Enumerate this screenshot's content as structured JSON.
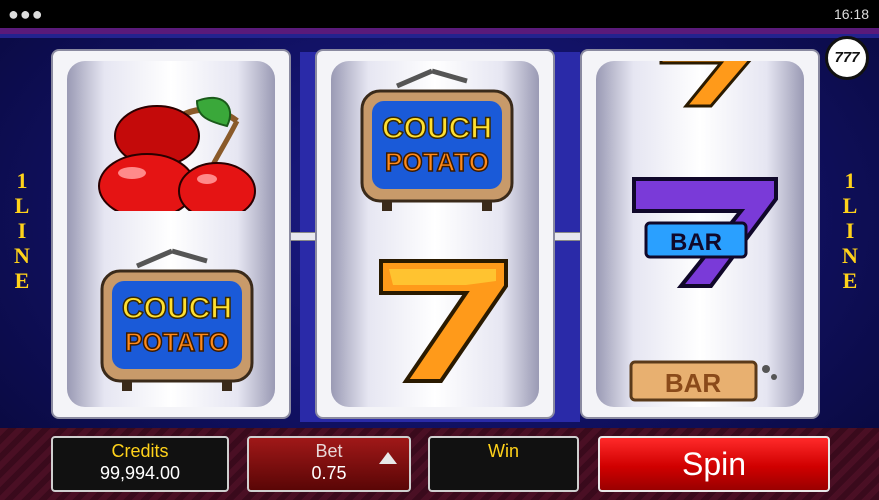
{
  "status_bar": {
    "menu_icon": "ellipsis-icon",
    "time": "16:18"
  },
  "game": {
    "logo": "777",
    "paylines_left": [
      "1",
      "L",
      "I",
      "N",
      "E"
    ],
    "paylines_right": [
      "1",
      "L",
      "I",
      "N",
      "E"
    ],
    "reels": [
      {
        "symbols": [
          "cherries",
          "couch-potato"
        ]
      },
      {
        "symbols": [
          "couch-potato",
          "seven"
        ]
      },
      {
        "symbols": [
          "seven-partial",
          "seven-bar",
          "bar"
        ]
      }
    ],
    "symbol_text": {
      "couch_line1": "COUCH",
      "couch_line2": "POTATO",
      "seven": "7",
      "bar": "BAR"
    }
  },
  "controls": {
    "credits_label": "Credits",
    "credits_value": "99,994.00",
    "bet_label": "Bet",
    "bet_value": "0.75",
    "win_label": "Win",
    "win_value": "",
    "spin_label": "Spin"
  },
  "colors": {
    "accent_yellow": "#ffd21a",
    "spin_red": "#e00000",
    "reel_blue": "#2a2aa8"
  }
}
